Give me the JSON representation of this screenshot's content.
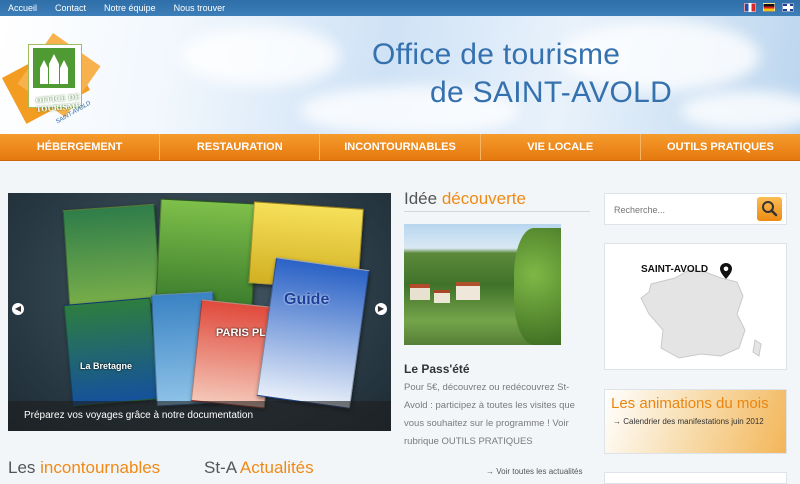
{
  "topnav": [
    "Accueil",
    "Contact",
    "Notre équipe",
    "Nous trouver"
  ],
  "languages": [
    {
      "code": "fr",
      "icon": "flag-fr-icon"
    },
    {
      "code": "de",
      "icon": "flag-de-icon"
    },
    {
      "code": "en",
      "icon": "flag-gb-icon"
    }
  ],
  "header": {
    "title_line1": "Office de tourisme",
    "title_line2": "de SAINT-AVOLD",
    "logo_text": "OFFICE DE TOURISME",
    "logo_subtext": "SAINT-AVOLD"
  },
  "mainnav": [
    "HÉBERGEMENT",
    "RESTAURATION",
    "INCONTOURNABLES",
    "VIE LOCALE",
    "OUTILS PRATIQUES"
  ],
  "slider": {
    "caption": "Préparez vos voyages grâce à notre documentation",
    "brochure_labels": [
      "La Bretagne",
      "PARIS PLAN",
      "Guide"
    ]
  },
  "idee": {
    "title_part1": "Idée",
    "title_part2": "découverte",
    "heading": "Le Pass'été",
    "text": "Pour 5€, découvrez ou redécouvrez St-Avold : participez à toutes les visites que vous souhaitez sur le programme ! Voir rubrique OUTILS PRATIQUES"
  },
  "sections": {
    "incontournables_part1": "Les",
    "incontournables_part2": "incontournables",
    "actualites_part1": "St-A",
    "actualites_part2": "Actualités",
    "more_news": "→ Voir toutes les actualités"
  },
  "sidebar": {
    "search_placeholder": "Recherche...",
    "map_label": "SAINT-AVOLD",
    "animations_title": "Les animations du mois",
    "animations_link": "→ Calendrier des manifestations juin 2012"
  },
  "colors": {
    "accent": "#ef8a16",
    "title_blue": "#3471ae",
    "topbar": "#2f6ea8"
  }
}
